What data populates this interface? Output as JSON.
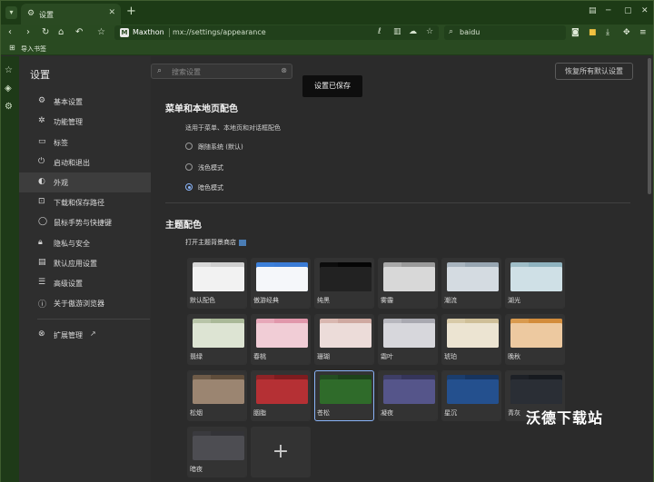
{
  "browser": {
    "tab_title": "设置",
    "brand": "Maxthon",
    "url": "mx://settings/appearance",
    "search_engine": "baidu",
    "bookmarks_label": "导入书签"
  },
  "settings": {
    "title": "设置",
    "search_placeholder": "搜索设置",
    "reset_label": "恢复所有默认设置",
    "toast": "设置已保存",
    "nav": [
      {
        "label": "基本设置",
        "icon": "gear-icon"
      },
      {
        "label": "功能管理",
        "icon": "puzzle-icon"
      },
      {
        "label": "标签",
        "icon": "tab-icon"
      },
      {
        "label": "启动和退出",
        "icon": "power-icon"
      },
      {
        "label": "外观",
        "icon": "palette-icon",
        "active": true
      },
      {
        "label": "下载和保存路径",
        "icon": "download-icon"
      },
      {
        "label": "鼠标手势与快捷键",
        "icon": "mouse-icon"
      },
      {
        "label": "隐私与安全",
        "icon": "lock-icon"
      },
      {
        "label": "默认应用设置",
        "icon": "app-icon"
      },
      {
        "label": "高级设置",
        "icon": "sliders-icon"
      },
      {
        "label": "关于傲游浏览器",
        "icon": "info-icon"
      }
    ],
    "extensions_label": "扩展管理"
  },
  "appearance": {
    "menu_section_title": "菜单和本地页配色",
    "menu_section_desc": "适用于菜单、本地页和对话框配色",
    "modes": [
      {
        "label": "跟随系统 (默认)",
        "selected": false
      },
      {
        "label": "浅色模式",
        "selected": false
      },
      {
        "label": "暗色模式",
        "selected": true
      }
    ],
    "theme_section_title": "主题配色",
    "theme_store_label": "打开主题背景商店",
    "themes": [
      {
        "name": "默认配色",
        "back": "#d8d8d8",
        "front": "#f2f2f2",
        "tab": "#cfcfcf",
        "selected": false
      },
      {
        "name": "傲游经典",
        "back": "#3c7fd8",
        "front": "#f5f7fa",
        "tab": "#3a7bd5",
        "selected": false
      },
      {
        "name": "纯黑",
        "back": "#0c0c0c",
        "front": "#222222",
        "tab": "#050505",
        "selected": false
      },
      {
        "name": "雾霾",
        "back": "#a9a9a9",
        "front": "#d8d8d8",
        "tab": "#9a9a9a",
        "selected": false
      },
      {
        "name": "潮流",
        "back": "#a7b3bd",
        "front": "#d4dbe1",
        "tab": "#97a5b1",
        "selected": false
      },
      {
        "name": "湖光",
        "back": "#9fbdc7",
        "front": "#cfe0e6",
        "tab": "#8fb3bf",
        "selected": false
      },
      {
        "name": "翡绿",
        "back": "#b8c4a8",
        "front": "#dde4d3",
        "tab": "#aab998",
        "selected": false
      },
      {
        "name": "春桃",
        "back": "#e7a8b9",
        "front": "#f1cdd6",
        "tab": "#e197ab",
        "selected": false
      },
      {
        "name": "珊瑚",
        "back": "#d9b7b0",
        "front": "#ecdcd9",
        "tab": "#cfa9a1",
        "selected": false
      },
      {
        "name": "霜叶",
        "back": "#b7b7be",
        "front": "#d7d7dc",
        "tab": "#a9a9b1",
        "selected": false
      },
      {
        "name": "琥珀",
        "back": "#d8caa8",
        "front": "#ece4d2",
        "tab": "#cfbf98",
        "selected": false
      },
      {
        "name": "晚秋",
        "back": "#d99a4e",
        "front": "#edc9a0",
        "tab": "#d38c3b",
        "selected": false
      },
      {
        "name": "松烟",
        "back": "#6e5b48",
        "front": "#9b8571",
        "tab": "#5f4d3b",
        "selected": false
      },
      {
        "name": "胭脂",
        "back": "#8f2326",
        "front": "#b53034",
        "tab": "#7e1c1f",
        "selected": false
      },
      {
        "name": "苍松",
        "back": "#234d20",
        "front": "#2f6b2a",
        "tab": "#1d421a",
        "selected": true
      },
      {
        "name": "凝夜",
        "back": "#3e3e66",
        "front": "#55558a",
        "tab": "#35355a",
        "selected": false
      },
      {
        "name": "星沉",
        "back": "#1b3d6d",
        "front": "#24508e",
        "tab": "#17345e",
        "selected": false
      },
      {
        "name": "青灰",
        "back": "#1d2026",
        "front": "#2a2e35",
        "tab": "#171a1f",
        "selected": false
      },
      {
        "name": "暗夜",
        "back": "#3a3a3e",
        "front": "#4d4d52",
        "tab": "#333337",
        "selected": false
      }
    ],
    "add_theme_label": "+"
  },
  "watermark": "沃德下载站"
}
